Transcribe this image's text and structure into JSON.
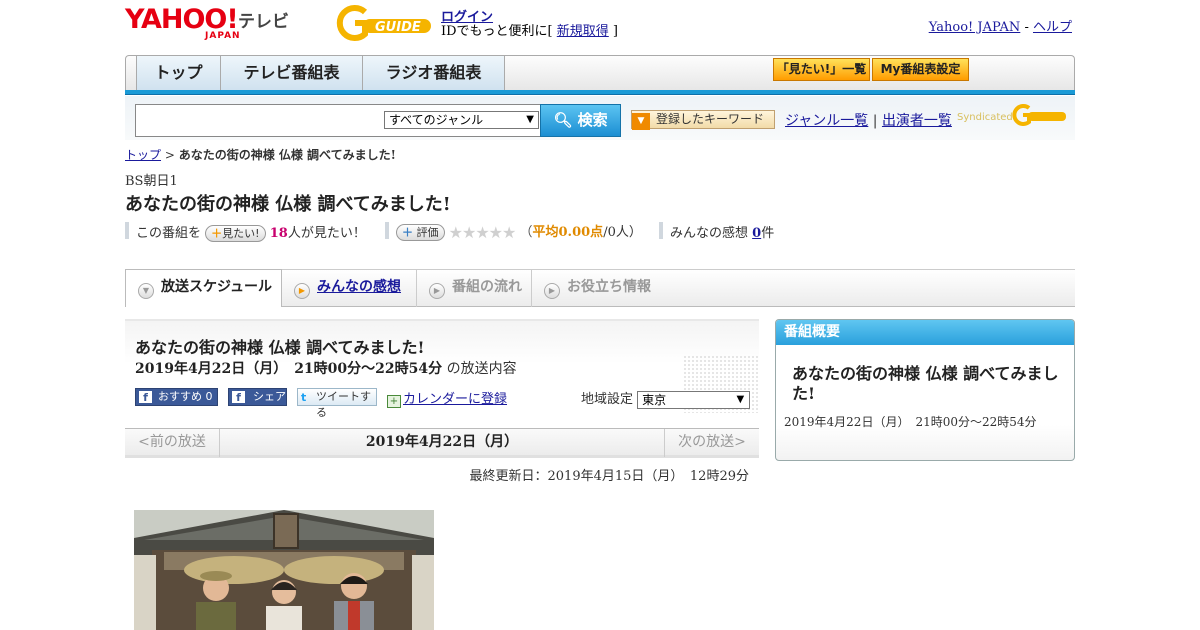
{
  "header": {
    "yahoo_logo": "YAHOO!",
    "japan_logo": "JAPAN",
    "tv_label": "テレビ",
    "gguide_logo": "G-GUIDE",
    "login_label": "ログイン",
    "id_text_prefix": "IDでもっと便利に[ ",
    "signup_label": "新規取得",
    "id_text_suffix": " ]",
    "yahoo_japan_link": "Yahoo! JAPAN",
    "separator": " - ",
    "help_link": "ヘルプ"
  },
  "nav": {
    "tabs": [
      "トップ",
      "テレビ番組表",
      "ラジオ番組表"
    ],
    "mitai_list_button": "「見たい!」一覧",
    "my_schedule_button": "My番組表設定"
  },
  "search": {
    "input_value": "",
    "genre_select": "すべてのジャンル",
    "search_button": "検索",
    "keyword_button": "登録したキーワード",
    "genre_list_link": "ジャンル一覧",
    "divider": "|",
    "performer_list_link": "出演者一覧",
    "syndicated_label": "Syndicated"
  },
  "breadcrumb": {
    "top_link": "トップ",
    "sep": " > ",
    "current": "あなたの街の神様 仏様 調べてみました!"
  },
  "program": {
    "channel": "BS朝日1",
    "title": "あなたの街の神様 仏様 調べてみました!",
    "mitai_prefix": "この番組を",
    "mitai_button": "見たい!",
    "mitai_count": "18",
    "mitai_suffix": "人が見たい！",
    "rate_button": "評価",
    "rating_stars": 0,
    "rating_open": "（",
    "rating_avg_label": "平均0.00点",
    "rating_count": "/0人）",
    "kanso_prefix": "みんなの感想 ",
    "kanso_count": "0",
    "kanso_suffix": "件"
  },
  "tabs": [
    "放送スケジュール",
    "みんなの感想",
    "番組の流れ",
    "お役立ち情報"
  ],
  "broadcast": {
    "title": "あなたの街の神様 仏様 調べてみました!",
    "datetime": "2019年4月22日（月）　21時00分～22時54分",
    "datetime_suffix": " の放送内容",
    "fb_recommend": "おすすめ",
    "fb_recommend_count": "0",
    "fb_share": "シェア",
    "tweet": "ツイートする",
    "calendar_link": "カレンダーに登録",
    "region_label": "地域設定",
    "region_value": "東京",
    "prev_label": "<前の放送",
    "current_date": "2019年4月22日（月）",
    "next_label": "次の放送>",
    "last_updated": "最終更新日：2019年4月15日（月）　12時29分"
  },
  "sidebar": {
    "heading": "番組概要",
    "title": "あなたの街の神様 仏様 調べてみました!",
    "datetime": "2019年4月22日（月）　21時00分～22時54分"
  },
  "colors": {
    "yahoo_red": "#e60012",
    "nav_blue": "#1a9ad6",
    "gguide_yellow": "#f5b400",
    "link_blue": "#1a1a9c",
    "accent_orange": "#f39800"
  }
}
